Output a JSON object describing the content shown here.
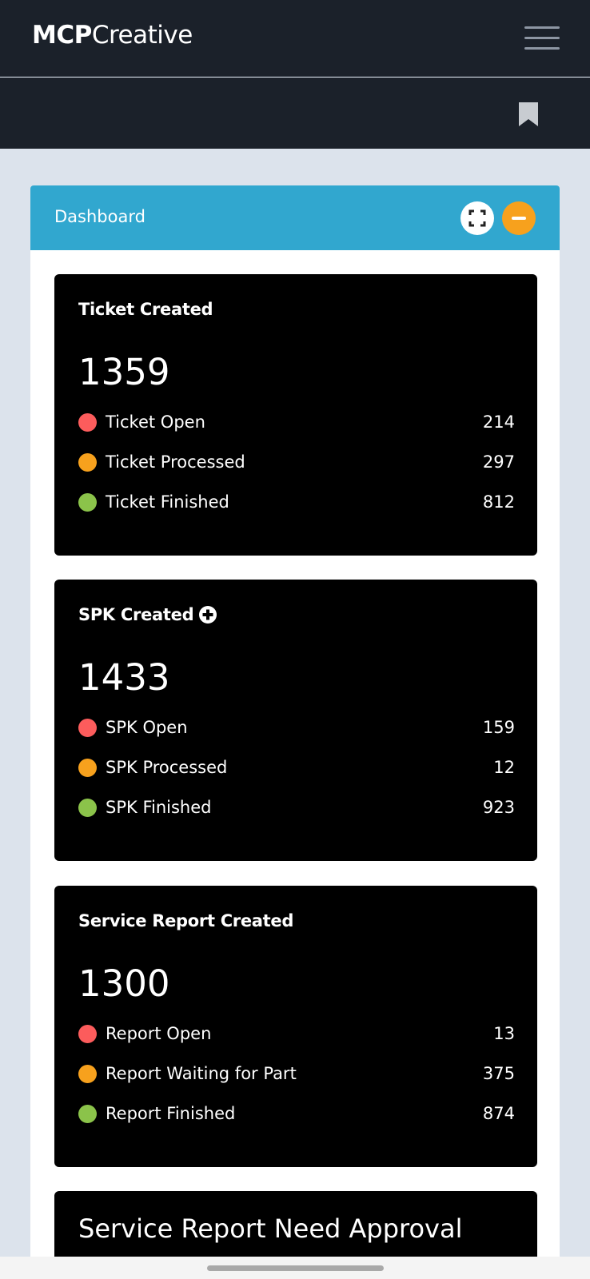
{
  "app": {
    "brand_bold": "MCP",
    "brand_light": "Creative"
  },
  "panel": {
    "title": "Dashboard"
  },
  "cards": [
    {
      "title": "Ticket Created",
      "total": "1359",
      "rows": [
        {
          "label": "Ticket Open",
          "value": "214",
          "color": "#fc5c5c"
        },
        {
          "label": "Ticket Processed",
          "value": "297",
          "color": "#f7a11d"
        },
        {
          "label": "Ticket Finished",
          "value": "812",
          "color": "#8bc34a"
        }
      ]
    },
    {
      "title": "SPK Created",
      "total": "1433",
      "rows": [
        {
          "label": "SPK Open",
          "value": "159",
          "color": "#fc5c5c"
        },
        {
          "label": "SPK Processed",
          "value": "12",
          "color": "#f7a11d"
        },
        {
          "label": "SPK Finished",
          "value": "923",
          "color": "#8bc34a"
        }
      ]
    },
    {
      "title": "Service Report Created",
      "total": "1300",
      "rows": [
        {
          "label": "Report Open",
          "value": "13",
          "color": "#fc5c5c"
        },
        {
          "label": "Report Waiting for Part",
          "value": "375",
          "color": "#f7a11d"
        },
        {
          "label": "Report Finished",
          "value": "874",
          "color": "#8bc34a"
        }
      ]
    }
  ],
  "approval_card": {
    "title": "Service Report Need Approval"
  },
  "icons": {
    "menu": "hamburger-menu-icon",
    "bookmark": "bookmark-icon",
    "expand": "fullscreen-icon",
    "collapse": "minus-icon",
    "add": "plus-circle-icon"
  },
  "colors": {
    "header_bg": "#1b212a",
    "panel_header": "#31a7cf",
    "accent_orange": "#f7a11d"
  }
}
